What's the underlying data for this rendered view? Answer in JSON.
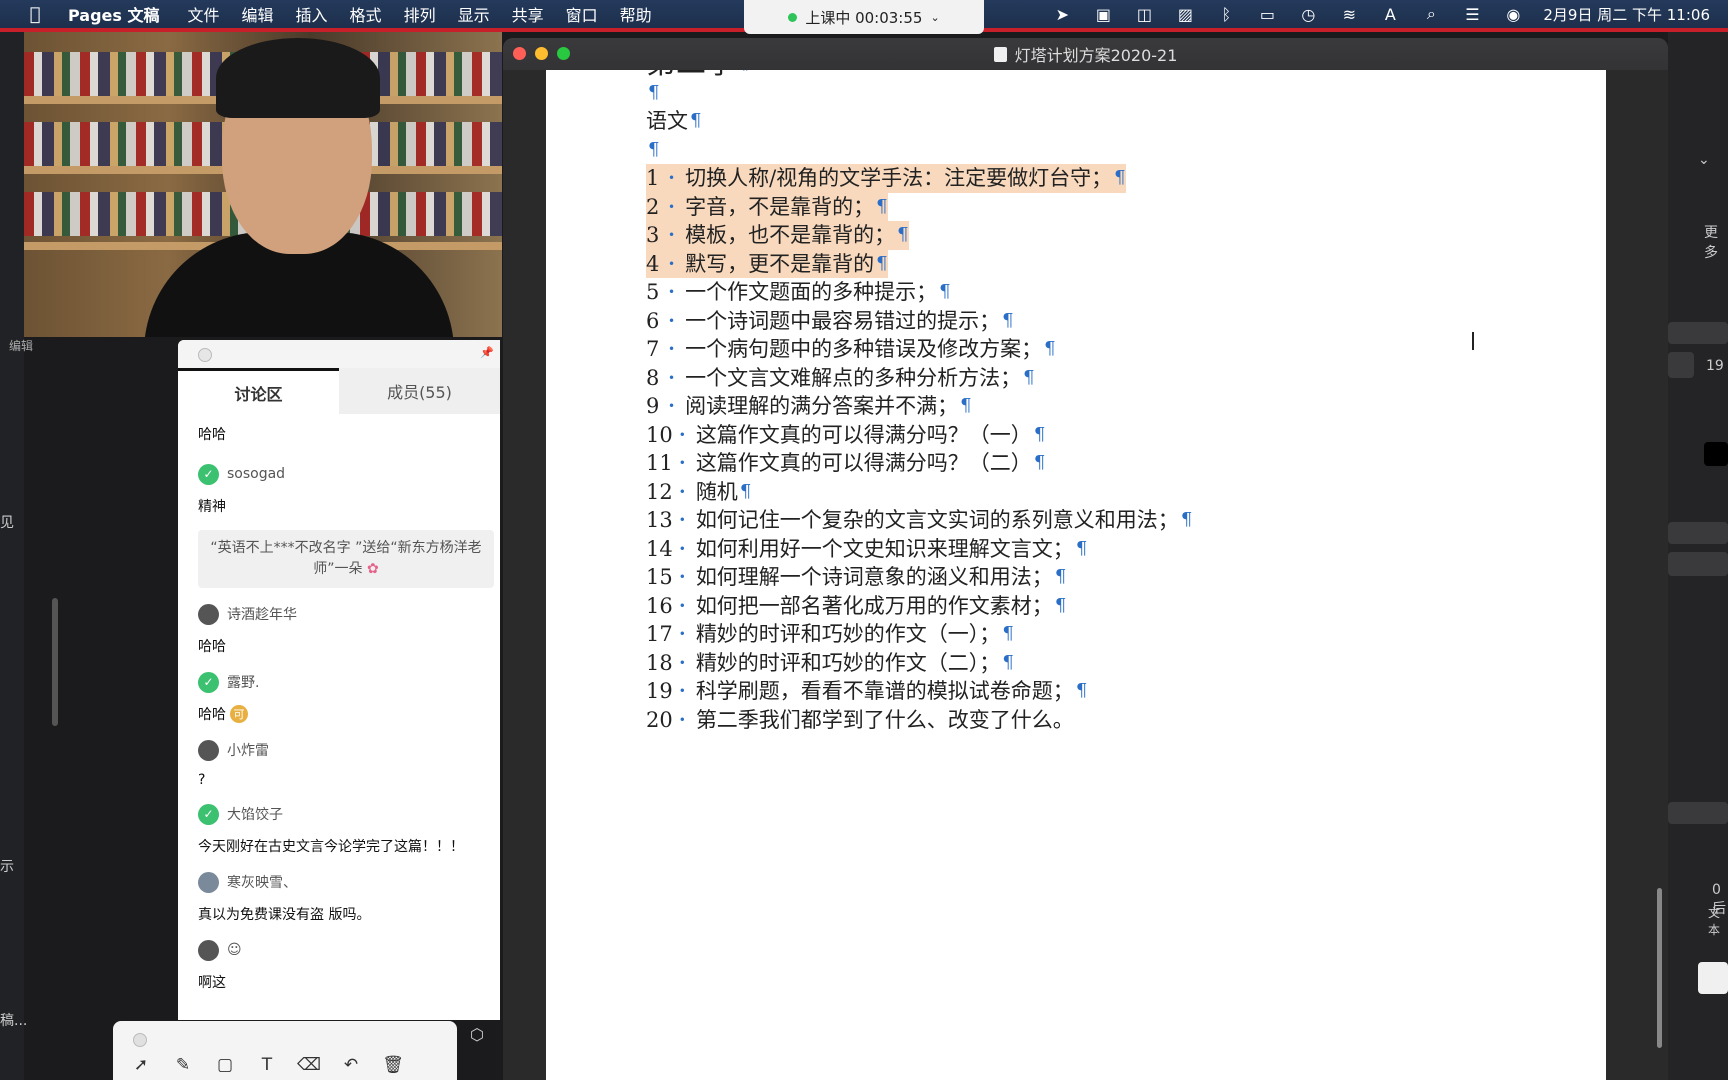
{
  "menubar": {
    "app": "Pages 文稿",
    "items": [
      "文件",
      "编辑",
      "插入",
      "格式",
      "排列",
      "显示",
      "共享",
      "窗口",
      "帮助"
    ],
    "clock": "2月9日 周二 下午 11:06"
  },
  "class_status": "上课中 00:03:55",
  "left_strip": {
    "edit": "编辑",
    "t1": "见",
    "t2": "示",
    "t3": "稿..."
  },
  "chat": {
    "tabs": [
      "讨论区",
      "成员(55)"
    ],
    "messages": [
      {
        "user": "",
        "text": "哈哈"
      },
      {
        "user": "sosogad",
        "text": "精神"
      },
      {
        "user": "诗酒趁年华",
        "text": "哈哈"
      },
      {
        "user": "露野.",
        "text": "哈哈"
      },
      {
        "user": "小炸雷",
        "text": "?"
      },
      {
        "user": "大馅饺子",
        "text": "今天刚好在古史文言今论学完了这篇！！！"
      },
      {
        "user": "寒灰映雪、",
        "text": "真以为免费课没有盗 版吗。"
      },
      {
        "user": "",
        "text": "啊这"
      }
    ],
    "gift": "“英语不上***不改名字 ”送给“新东方杨洋老师”一朵",
    "emoji_fire": "可",
    "emoji_smile": "☺"
  },
  "window": {
    "title": "灯塔计划方案2020-21"
  },
  "document": {
    "heading": "第二季",
    "subject": "语文",
    "items": [
      {
        "n": "1",
        "text": "切换人称/视角的文学手法：注定要做灯台守；",
        "hl": true
      },
      {
        "n": "2",
        "text": "字音，不是靠背的；",
        "hl": true
      },
      {
        "n": "3",
        "text": "模板，也不是靠背的；",
        "hl": true
      },
      {
        "n": "4",
        "text": "默写，更不是靠背的",
        "hl": true
      },
      {
        "n": "5",
        "text": "一个作文题面的多种提示；",
        "hl": false
      },
      {
        "n": "6",
        "text": "一个诗词题中最容易错过的提示；",
        "hl": false
      },
      {
        "n": "7",
        "text": "一个病句题中的多种错误及修改方案；",
        "hl": false
      },
      {
        "n": "8",
        "text": "一个文言文难解点的多种分析方法；",
        "hl": false
      },
      {
        "n": "9",
        "text": "阅读理解的满分答案并不满；",
        "hl": false
      },
      {
        "n": "10",
        "text": "这篇作文真的可以得满分吗？（一）",
        "hl": false
      },
      {
        "n": "11",
        "text": "这篇作文真的可以得满分吗？（二）",
        "hl": false
      },
      {
        "n": "12",
        "text": "随机",
        "hl": false
      },
      {
        "n": "13",
        "text": "如何记住一个复杂的文言文实词的系列意义和用法；",
        "hl": false
      },
      {
        "n": "14",
        "text": "如何利用好一个文史知识来理解文言文；",
        "hl": false
      },
      {
        "n": "15",
        "text": "如何理解一个诗词意象的涵义和用法；",
        "hl": false
      },
      {
        "n": "16",
        "text": "如何把一部名著化成万用的作文素材；",
        "hl": false
      },
      {
        "n": "17",
        "text": "精妙的时评和巧妙的作文（一）；",
        "hl": false
      },
      {
        "n": "18",
        "text": "精妙的时评和巧妙的作文（二）；",
        "hl": false
      },
      {
        "n": "19",
        "text": "科学刷题，看看不靠谱的模拟试卷命题；",
        "hl": false
      },
      {
        "n": "20",
        "text": "第二季我们都学到了什么、改变了什么。",
        "hl": false,
        "nopil": true
      }
    ]
  },
  "inspector": {
    "more": "更多",
    "size": "19",
    "zero": "0 后",
    "textlabel": "文本"
  }
}
